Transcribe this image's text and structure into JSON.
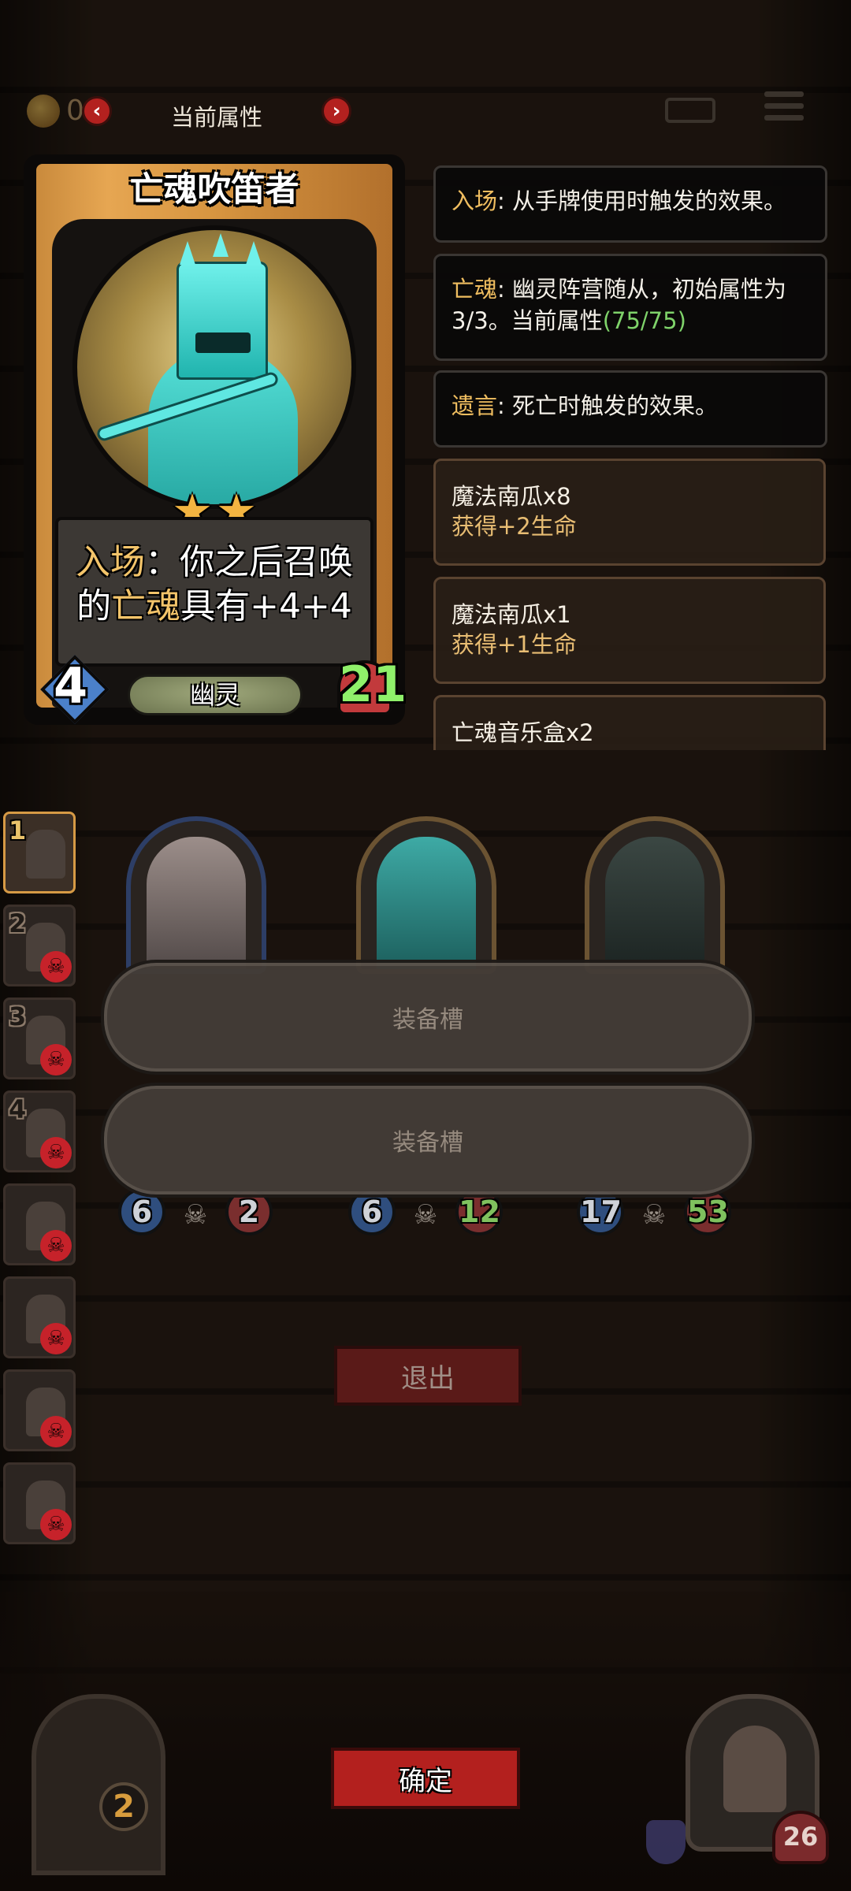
{
  "topbar": {
    "coin_value": "0",
    "title": "当前属性",
    "prev_glyph": "‹",
    "next_glyph": "›"
  },
  "card": {
    "name": "亡魂吹笛者",
    "stars": 2,
    "effect_keyword": "入场",
    "effect_part1": "：你之后召唤",
    "effect_line2_pre": "的",
    "effect_tribe_kw": "亡魂",
    "effect_line2_post": "具有+4+4",
    "attack": "4",
    "health": "21",
    "tribe": "幽灵"
  },
  "info": {
    "battlecry_kw": "入场",
    "battlecry_text": ": 从手牌使用时触发的效果。",
    "soul_kw": "亡魂",
    "soul_text": ": 幽灵阵营随从，初始属性为3/3。当前属性",
    "soul_stats": "(75/75)",
    "deathrattle_kw": "遗言",
    "deathrattle_text": ": 死亡时触发的效果。"
  },
  "relics": [
    {
      "name": "魔法南瓜x8",
      "effect": "获得+2生命"
    },
    {
      "name": "魔法南瓜x1",
      "effect": "获得+1生命"
    },
    {
      "name": "亡魂音乐盒x2",
      "effect": ""
    }
  ],
  "roster": [
    "1",
    "2",
    "3",
    "4",
    "",
    "",
    "",
    ""
  ],
  "minions": [
    {
      "attack": "6",
      "health": "2"
    },
    {
      "attack": "6",
      "health": "12"
    },
    {
      "attack": "17",
      "health": "53"
    }
  ],
  "equip": {
    "slot1": "装备槽",
    "slot2": "装备槽"
  },
  "buttons": {
    "exit": "退出",
    "confirm": "确定"
  },
  "footer": {
    "gate_number": "2",
    "hero_health": "26"
  },
  "colors": {
    "accent_red": "#b3201e",
    "keyword_gold": "#f0be60",
    "stat_green": "#7fd36a"
  }
}
